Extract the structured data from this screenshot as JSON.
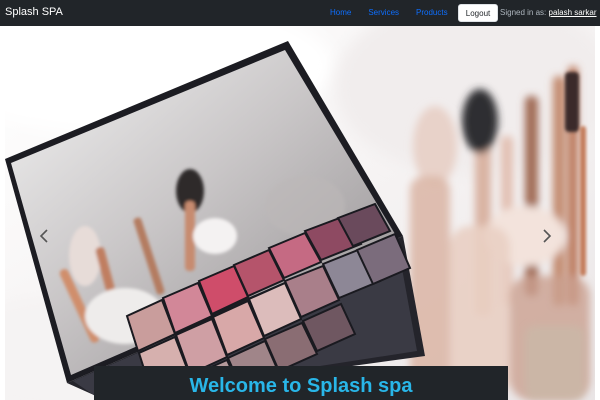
{
  "navbar": {
    "brand": "Splash SPA",
    "links": [
      "Home",
      "Services",
      "Products"
    ],
    "logout_label": "Logout",
    "signed_in_prefix": "Signed in as:",
    "username": "palash sarkar",
    "link_color": "#0d6efd",
    "background": "#212529"
  },
  "carousel": {
    "slide_image": "makeup-palette-and-brushes",
    "caption_title": "Welcome to Splash spa",
    "caption_color": "#29b6e8",
    "prev_icon": "chevron-left-icon",
    "next_icon": "chevron-right-icon"
  }
}
